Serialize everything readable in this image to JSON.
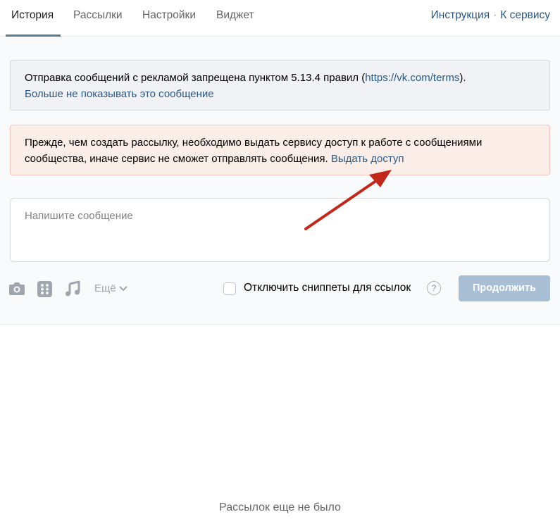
{
  "tabs": [
    {
      "label": "История",
      "active": true
    },
    {
      "label": "Рассылки"
    },
    {
      "label": "Настройки"
    },
    {
      "label": "Виджет"
    }
  ],
  "links": {
    "instruction": "Инструкция",
    "separator": "·",
    "to_service": "К сервису"
  },
  "info": {
    "text_before": "Отправка сообщений с рекламой запрещена пунктом 5.13.4 правил (",
    "url": "https://vk.com/terms",
    "text_after": ").",
    "dismiss": "Больше не показывать это сообщение"
  },
  "warning": {
    "text": "Прежде, чем создать рассылку, необходимо выдать сервису доступ к работе с сообщениями сообщества, иначе сервис не сможет отправлять сообщения.",
    "link": "Выдать доступ"
  },
  "compose": {
    "placeholder": "Напишите сообщение"
  },
  "toolbar": {
    "icons": [
      "camera-icon",
      "dice-icon",
      "music-icon"
    ],
    "more": "Ещё",
    "checkbox_label": "Отключить сниппеты для ссылок",
    "checkbox_checked": false,
    "help": "?",
    "continue": "Продолжить"
  },
  "empty_state": "Рассылок еще не было",
  "colors": {
    "link": "#2a5885",
    "button": "#a8bed5",
    "arrow": "#c0281b"
  }
}
